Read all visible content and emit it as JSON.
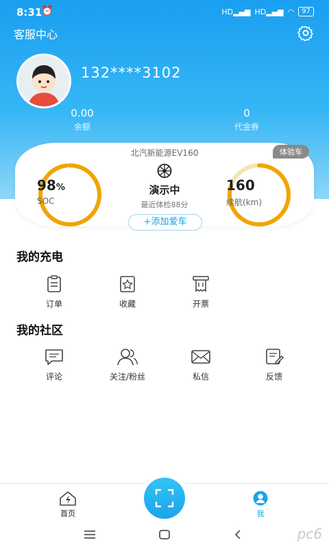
{
  "status_bar": {
    "time": "8:31",
    "signal1": "HD",
    "signal2": "HD",
    "battery": "97"
  },
  "header": {
    "title": "客服中心",
    "settings_icon": "gear-icon"
  },
  "profile": {
    "phone": "132****3102",
    "avatar_icon": "avatar-icon"
  },
  "stats": [
    {
      "value": "0.00",
      "label": "余额"
    },
    {
      "value": "0",
      "label": "代金券"
    }
  ],
  "car": {
    "name": "北汽新能源EV160",
    "badge": "体验车",
    "soc_value": "98",
    "soc_unit": "%",
    "soc_label": "SOC",
    "soc_fraction": 0.98,
    "status": "演示中",
    "check_score": "最近体检88分",
    "range_value": "160",
    "range_label": "续航(km)",
    "range_fraction": 0.8,
    "add_car": "+添加爱车"
  },
  "charging": {
    "title": "我的充电",
    "items": [
      {
        "label": "订单",
        "icon": "order-icon"
      },
      {
        "label": "收藏",
        "icon": "star-icon"
      },
      {
        "label": "开票",
        "icon": "invoice-icon"
      }
    ]
  },
  "community": {
    "title": "我的社区",
    "items": [
      {
        "label": "评论",
        "icon": "comment-icon"
      },
      {
        "label": "关注/粉丝",
        "icon": "users-icon"
      },
      {
        "label": "私信",
        "icon": "mail-icon"
      },
      {
        "label": "反馈",
        "icon": "feedback-icon"
      }
    ]
  },
  "tabbar": {
    "home": "首页",
    "me": "我",
    "accent": "#1aa4ea"
  },
  "watermark": "pc6"
}
